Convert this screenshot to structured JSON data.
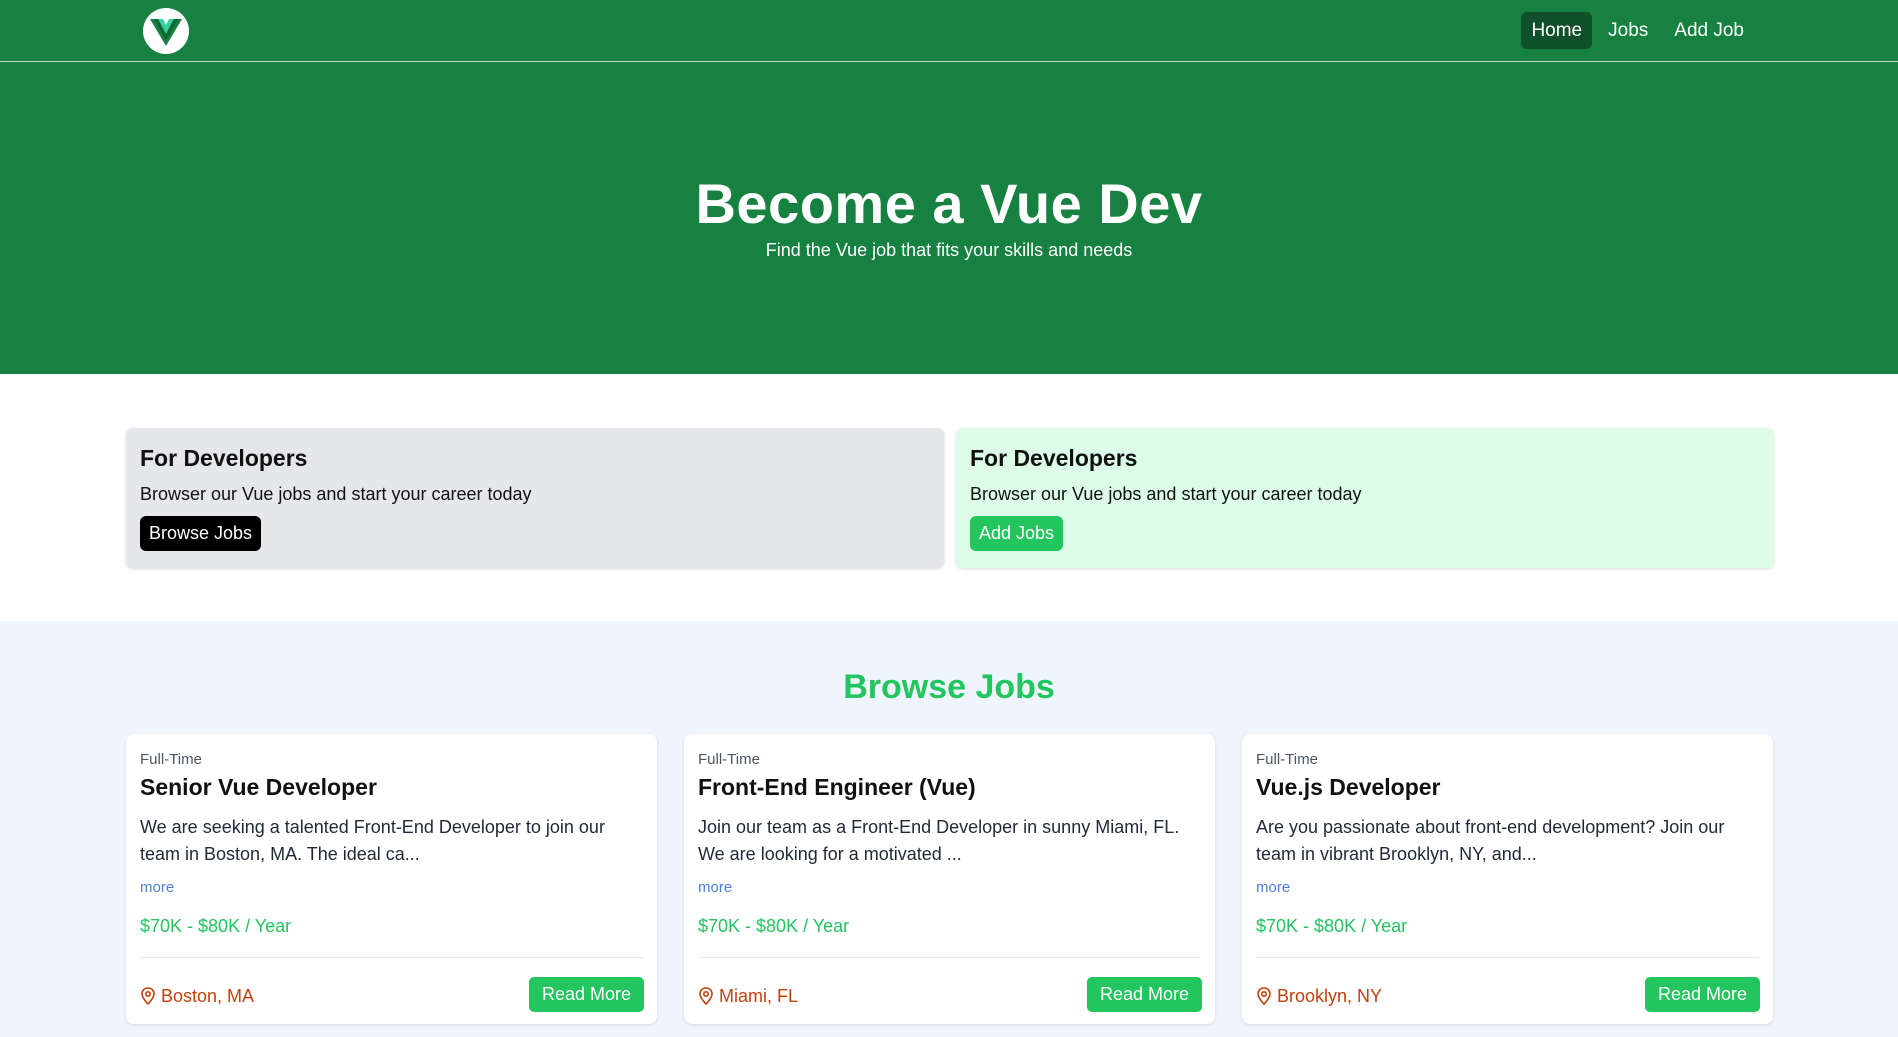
{
  "nav": {
    "logo_icon": "vue-logo-icon",
    "links": [
      {
        "label": "Home",
        "active": true
      },
      {
        "label": "Jobs",
        "active": false
      },
      {
        "label": "Add Job",
        "active": false
      }
    ]
  },
  "hero": {
    "title": "Become a Vue Dev",
    "subtitle": "Find the Vue job that fits your skills and needs"
  },
  "cta_cards": [
    {
      "title": "For Developers",
      "text": "Browser our Vue jobs and start your career today",
      "button": "Browse Jobs"
    },
    {
      "title": "For Developers",
      "text": "Browser our Vue jobs and start your career today",
      "button": "Add Jobs"
    }
  ],
  "browse": {
    "title": "Browse Jobs",
    "jobs": [
      {
        "type": "Full-Time",
        "title": "Senior Vue Developer",
        "description": "We are seeking a talented Front-End Developer to join our team in Boston, MA. The ideal ca...",
        "more": "more",
        "salary": "$70K - $80K / Year",
        "location": "Boston, MA",
        "button": "Read More"
      },
      {
        "type": "Full-Time",
        "title": "Front-End Engineer (Vue)",
        "description": "Join our team as a Front-End Developer in sunny Miami, FL. We are looking for a motivated ...",
        "more": "more",
        "salary": "$70K - $80K / Year",
        "location": "Miami, FL",
        "button": "Read More"
      },
      {
        "type": "Full-Time",
        "title": "Vue.js Developer",
        "description": "Are you passionate about front-end development? Join our team in vibrant Brooklyn, NY, and...",
        "more": "more",
        "salary": "$70K - $80K / Year",
        "location": "Brooklyn, NY",
        "button": "Read More"
      }
    ]
  },
  "colors": {
    "brand_green": "#168140",
    "accent_green": "#22c55e",
    "location_orange": "#c2410c"
  }
}
